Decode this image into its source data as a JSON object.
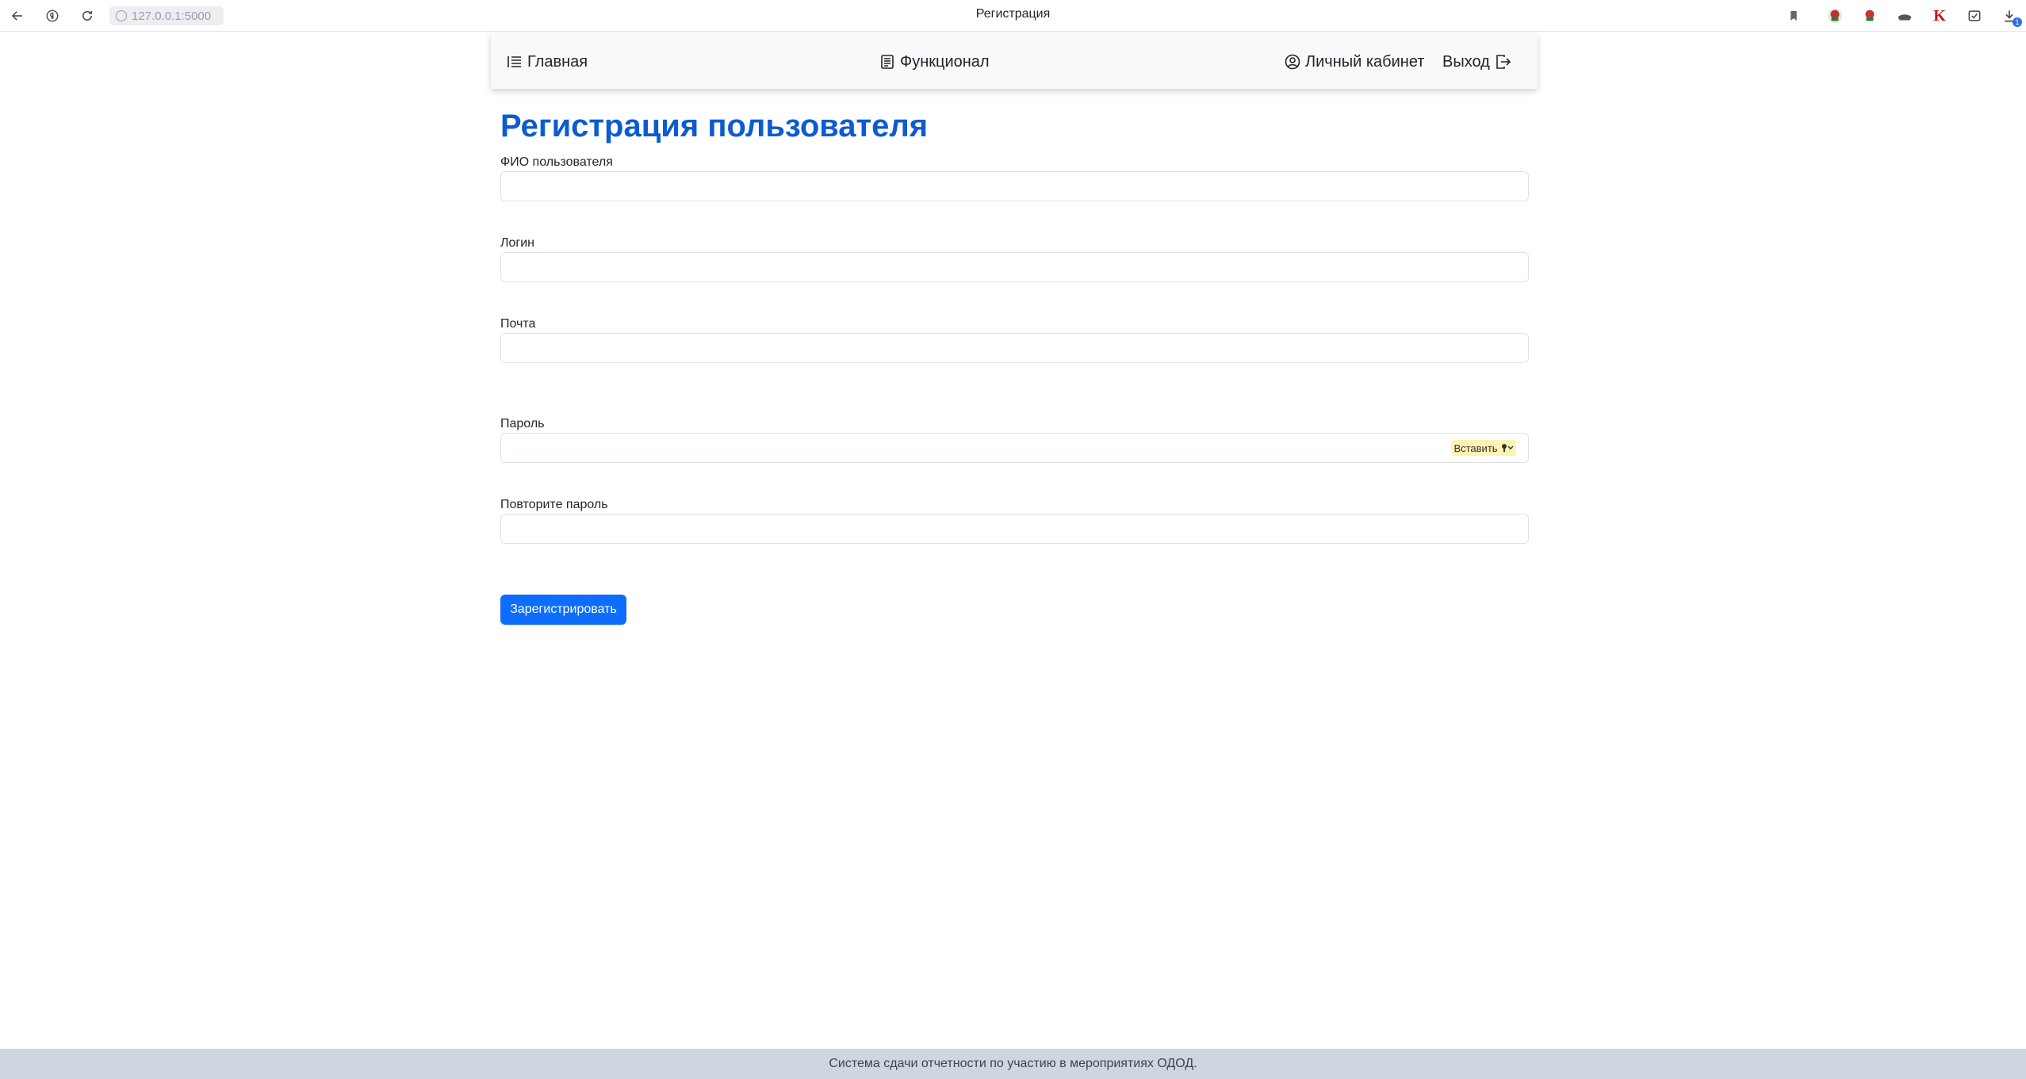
{
  "browser": {
    "url": "127.0.0.1:5000",
    "tab_title": "Регистрация",
    "download_badge": "1"
  },
  "navbar": {
    "home_label": "Главная",
    "features_label": "Функционал",
    "account_label": "Личный кабинет",
    "logout_label": "Выход"
  },
  "form": {
    "title": "Регистрация пользователя",
    "fullname_label": "ФИО пользователя",
    "login_label": "Логин",
    "email_label": "Почта",
    "password_label": "Пароль",
    "password_paste_label": "Вставить",
    "repeat_password_label": "Повторите пароль",
    "submit_label": "Зарегистрировать"
  },
  "footer": {
    "text": "Система сдачи отчетности по участию в мероприятиях ОДОД."
  },
  "colors": {
    "title": "#0d5bd1",
    "primary_button": "#0d6efd",
    "footer_bg": "#d0d6df",
    "navbar_bg": "#f8f9fa"
  }
}
